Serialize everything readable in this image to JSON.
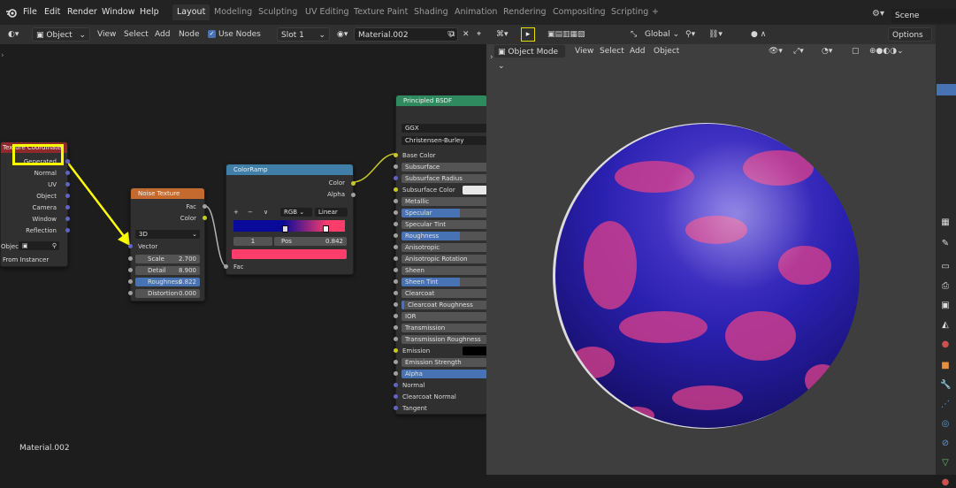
{
  "topbar": {
    "menus": [
      "File",
      "Edit",
      "Render",
      "Window",
      "Help"
    ],
    "workspaces": [
      "Layout",
      "Modeling",
      "Sculpting",
      "UV Editing",
      "Texture Paint",
      "Shading",
      "Animation",
      "Rendering",
      "Compositing",
      "Scripting"
    ],
    "active_workspace": "Layout",
    "add_tab": "+",
    "scene": "Scene"
  },
  "node_header": {
    "object_mode": "Object",
    "menus": [
      "View",
      "Select",
      "Add",
      "Node"
    ],
    "use_nodes_label": "Use Nodes",
    "slot": "Slot 1",
    "material": "Material.002"
  },
  "viewport_header": {
    "orientation": "Global",
    "options": "Options",
    "mode": "Object Mode",
    "menus": [
      "View",
      "Select",
      "Add",
      "Object"
    ]
  },
  "node_canvas_label": "Material.002",
  "tex_coord": {
    "title": "Texture Coordinate",
    "outputs": [
      "Generated",
      "Normal",
      "UV",
      "Object",
      "Camera",
      "Window",
      "Reflection"
    ],
    "object_label": "Object:",
    "from_instancer": "From Instancer"
  },
  "noise": {
    "title": "Noise Texture",
    "outputs": [
      "Fac",
      "Color"
    ],
    "dim": "3D",
    "vector_label": "Vector",
    "fields": [
      {
        "label": "Scale",
        "value": "2.700"
      },
      {
        "label": "Detail",
        "value": "8.900"
      },
      {
        "label": "Roughness",
        "value": "0.822"
      },
      {
        "label": "Distortion",
        "value": "0.000"
      }
    ]
  },
  "colorramp": {
    "title": "ColorRamp",
    "outputs": [
      "Color",
      "Alpha"
    ],
    "controls": [
      "+",
      "−",
      "∨"
    ],
    "mode": "RGB",
    "interp": "Linear",
    "index": "1",
    "pos_label": "Pos",
    "pos_value": "0.842",
    "fac_label": "Fac",
    "stop_color": "#ff3d6b",
    "gradient_from": "#0a0a9a",
    "gradient_to": "#ff3d6b"
  },
  "bsdf": {
    "title": "Principled BSDF",
    "distribution": "GGX",
    "subsurface_method": "Christensen-Burley",
    "inputs": [
      {
        "label": "Base Color",
        "socket": "y",
        "style": "plain"
      },
      {
        "label": "Subsurface",
        "socket": "g",
        "style": "field"
      },
      {
        "label": "Subsurface Radius",
        "socket": "p",
        "style": "field"
      },
      {
        "label": "Subsurface Color",
        "socket": "y",
        "style": "white"
      },
      {
        "label": "Metallic",
        "socket": "g",
        "style": "field"
      },
      {
        "label": "Specular",
        "socket": "g",
        "style": "blue"
      },
      {
        "label": "Specular Tint",
        "socket": "g",
        "style": "field"
      },
      {
        "label": "Roughness",
        "socket": "g",
        "style": "blue"
      },
      {
        "label": "Anisotropic",
        "socket": "g",
        "style": "field"
      },
      {
        "label": "Anisotropic Rotation",
        "socket": "g",
        "style": "field"
      },
      {
        "label": "Sheen",
        "socket": "g",
        "style": "field"
      },
      {
        "label": "Sheen Tint",
        "socket": "g",
        "style": "blue"
      },
      {
        "label": "Clearcoat",
        "socket": "g",
        "style": "field"
      },
      {
        "label": "Clearcoat Roughness",
        "socket": "g",
        "style": "field"
      },
      {
        "label": "IOR",
        "socket": "g",
        "style": "field"
      },
      {
        "label": "Transmission",
        "socket": "g",
        "style": "field"
      },
      {
        "label": "Transmission Roughness",
        "socket": "g",
        "style": "field"
      },
      {
        "label": "Emission",
        "socket": "y",
        "style": "black"
      },
      {
        "label": "Emission Strength",
        "socket": "g",
        "style": "field"
      },
      {
        "label": "Alpha",
        "socket": "g",
        "style": "fullblue"
      },
      {
        "label": "Normal",
        "socket": "p",
        "style": "plain"
      },
      {
        "label": "Clearcoat Normal",
        "socket": "p",
        "style": "plain"
      },
      {
        "label": "Tangent",
        "socket": "p",
        "style": "plain"
      }
    ]
  },
  "colors": {
    "accent": "#4772b3",
    "highlight": "#ffff00",
    "sphere_blue": "#2a20b0",
    "sphere_pink": "#e0408a"
  }
}
